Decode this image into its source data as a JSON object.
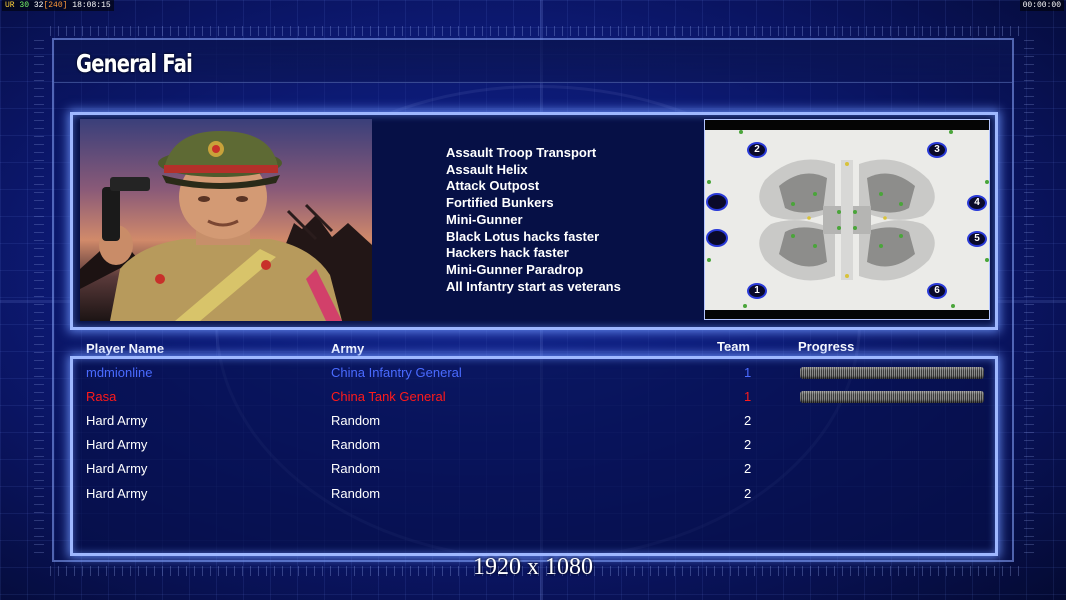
{
  "debug": {
    "fps_parts": [
      "UR",
      "30",
      "32",
      "[240]"
    ],
    "clock": "18:08:15",
    "timer": "00:00:00"
  },
  "screen": {
    "title": "General Fai",
    "resolution": "1920 x 1080"
  },
  "general": {
    "name": "General Fai",
    "abilities": [
      "Assault Troop Transport",
      "Assault Helix",
      "Attack Outpost",
      "Fortified Bunkers",
      "Mini-Gunner",
      "Black Lotus hacks faster",
      "Hackers hack faster",
      "Mini-Gunner Paradrop",
      "All Infantry start as veterans"
    ]
  },
  "minimap": {
    "start_positions": [
      "1",
      "2",
      "3",
      "4",
      "5",
      "6"
    ]
  },
  "player_table": {
    "columns": {
      "name": "Player Name",
      "army": "Army",
      "team": "Team",
      "progress": "Progress"
    },
    "rows": [
      {
        "name": "mdmionline",
        "army": "China Infantry General",
        "team": "1",
        "color": "#4a6bff",
        "progress": 1.0
      },
      {
        "name": "Rasa",
        "army": "China Tank General",
        "team": "1",
        "color": "#ff1a1a",
        "progress": 1.0
      },
      {
        "name": "Hard Army",
        "army": "Random",
        "team": "2",
        "color": "#ffffff",
        "progress": null
      },
      {
        "name": "Hard Army",
        "army": "Random",
        "team": "2",
        "color": "#ffffff",
        "progress": null
      },
      {
        "name": "Hard Army",
        "army": "Random",
        "team": "2",
        "color": "#ffffff",
        "progress": null
      },
      {
        "name": "Hard Army",
        "army": "Random",
        "team": "2",
        "color": "#ffffff",
        "progress": null
      }
    ]
  }
}
